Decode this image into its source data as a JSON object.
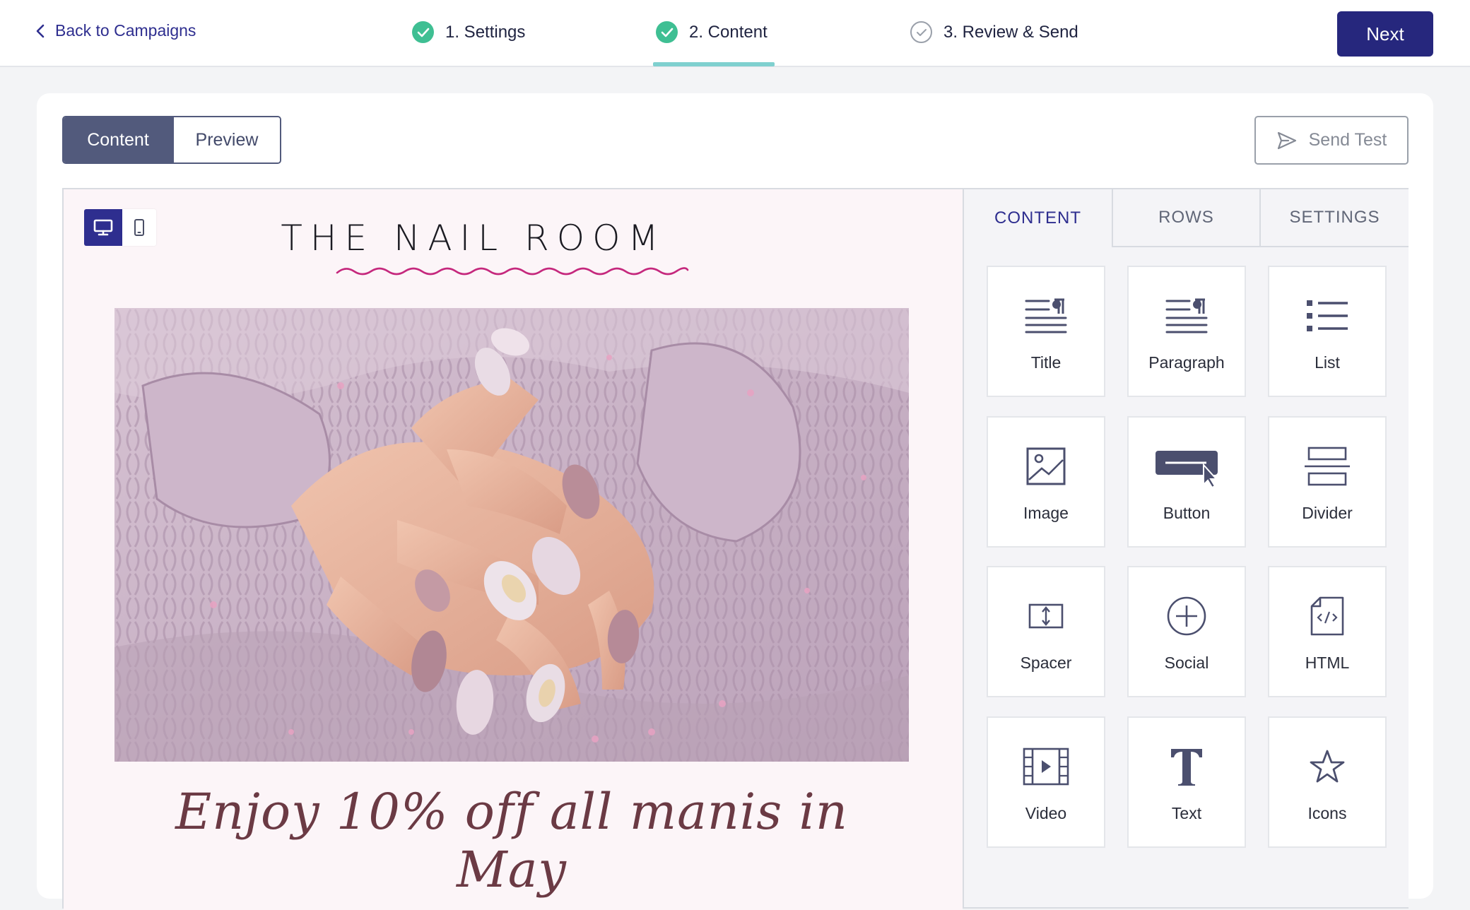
{
  "topbar": {
    "back_label": "Back to Campaigns",
    "steps": [
      {
        "label": "1. Settings",
        "status": "done"
      },
      {
        "label": "2. Content",
        "status": "done"
      },
      {
        "label": "3. Review & Send",
        "status": "todo"
      }
    ],
    "next_label": "Next"
  },
  "toolbar": {
    "modes": [
      "Content",
      "Preview"
    ],
    "active_mode": "Content",
    "send_test_label": "Send Test"
  },
  "canvas": {
    "view": "desktop",
    "brand_title": "THE NAIL ROOM",
    "hero_image_alt": "manicured hands on knit sweater",
    "promo_text": "Enjoy 10% off all manis in May"
  },
  "panel": {
    "tabs": [
      "CONTENT",
      "ROWS",
      "SETTINGS"
    ],
    "active_tab": "CONTENT",
    "blocks": [
      {
        "label": "Title",
        "icon": "title-icon"
      },
      {
        "label": "Paragraph",
        "icon": "paragraph-icon"
      },
      {
        "label": "List",
        "icon": "list-icon"
      },
      {
        "label": "Image",
        "icon": "image-icon"
      },
      {
        "label": "Button",
        "icon": "button-icon"
      },
      {
        "label": "Divider",
        "icon": "divider-icon"
      },
      {
        "label": "Spacer",
        "icon": "spacer-icon"
      },
      {
        "label": "Social",
        "icon": "social-icon"
      },
      {
        "label": "HTML",
        "icon": "html-icon"
      },
      {
        "label": "Video",
        "icon": "video-icon"
      },
      {
        "label": "Text",
        "icon": "text-icon"
      },
      {
        "label": "Icons",
        "icon": "star-icon"
      }
    ]
  },
  "colors": {
    "primary": "#26277d",
    "step_done": "#3fbf93",
    "step_underline": "#7fd0cf",
    "canvas_bg": "#fcf5f8",
    "promo_text": "#6b3a44",
    "wave": "#c5287d"
  }
}
